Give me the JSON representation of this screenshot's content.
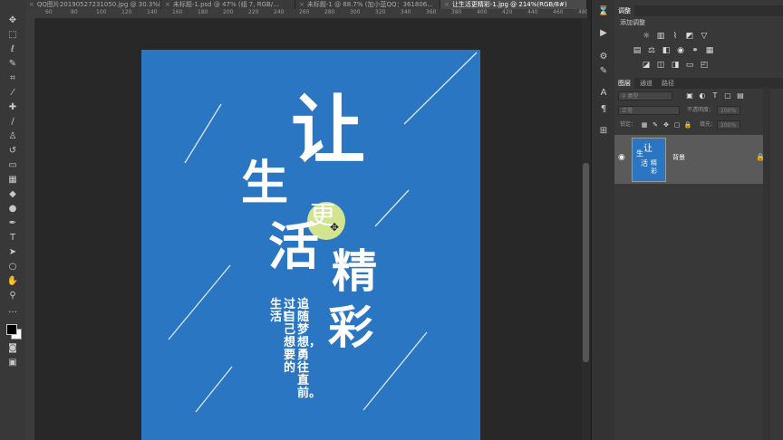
{
  "tabs": [
    {
      "label": "QQ图片20190527231050.jpg @ 30.3%(R..."
    },
    {
      "label": "未标题-1.psd @ 47% (组 7, RGB/..."
    },
    {
      "label": "未标题-1 @ 88.7% (加小蓝QQ：361806..."
    },
    {
      "label": "让生活更精彩-1.jpg @ 214%(RGB/8#)"
    }
  ],
  "ruler_top_numbers": [
    "60",
    "80",
    "100",
    "120",
    "140",
    "160",
    "180",
    "200",
    "220",
    "240",
    "260",
    "280",
    "300",
    "320",
    "340",
    "360",
    "380",
    "400",
    "420",
    "440",
    "460",
    "480"
  ],
  "poster": {
    "char_rang": "让",
    "char_sheng": "生",
    "char_geng": "更",
    "char_huo": "活",
    "char_jing": "精",
    "char_cai": "彩",
    "slogan_right": "追随梦想，勇往直前。",
    "slogan_left": "过自己想要的生活！",
    "bg_color": "#2a76c3"
  },
  "panels": {
    "adjustments_tab": "调整",
    "add_adjustment": "添加调整",
    "layers_tab": "图层",
    "channels_tab": "通道",
    "paths_tab": "路径",
    "filter_kind": "类型",
    "blend_mode": "正常",
    "opacity_label": "不透明度：",
    "opacity_value": "100%",
    "lock_label": "锁定：",
    "fill_label": "填充：",
    "fill_value": "100%",
    "layer_name": "背景"
  },
  "colors": {
    "foreground": "#000000",
    "background": "#ffffff",
    "accent_cursor": "#e2ee8c"
  },
  "icons": [
    "move-icon",
    "marquee-icon",
    "lasso-icon",
    "quick-select-icon",
    "crop-icon",
    "eyedropper-icon",
    "healing-icon",
    "brush-icon",
    "stamp-icon",
    "history-brush-icon",
    "eraser-icon",
    "gradient-icon",
    "blur-icon",
    "dodge-icon",
    "pen-icon",
    "type-icon",
    "path-select-icon",
    "shape-icon",
    "hand-icon",
    "zoom-icon",
    "eye-icon",
    "lock-icon"
  ]
}
